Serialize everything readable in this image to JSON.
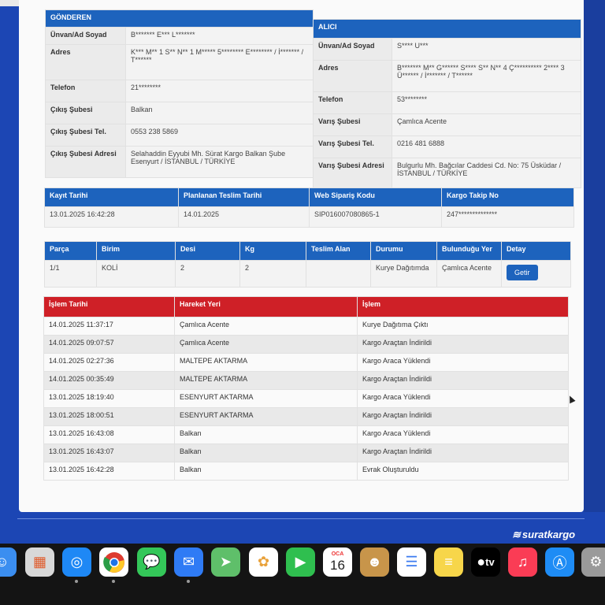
{
  "sender": {
    "header": "GÖNDEREN",
    "rows": [
      {
        "label": "Ünvan/Ad Soyad",
        "value": "B******* E*** L*******"
      },
      {
        "label": "Adres",
        "value": "K*** M** 1 S** N** 1 M***** 5******** E******** / İ******* / T******"
      },
      {
        "label": "Telefon",
        "value": "21********"
      },
      {
        "label": "Çıkış Şubesi",
        "value": "Balkan"
      },
      {
        "label": "Çıkış Şubesi Tel.",
        "value": "0553 238 5869"
      },
      {
        "label": "Çıkış Şubesi Adresi",
        "value": "Selahaddin Eyyubi Mh. Sürat Kargo Balkan Şube Esenyurt / İSTANBUL / TÜRKİYE"
      }
    ]
  },
  "receiver": {
    "header": "ALICI",
    "rows": [
      {
        "label": "Ünvan/Ad Soyad",
        "value": "S**** U***"
      },
      {
        "label": "Adres",
        "value": "B******* M** G****** S**** S** N** 4 Ç********** 2**** 3 Ü****** / İ******* / T******"
      },
      {
        "label": "Telefon",
        "value": "53********"
      },
      {
        "label": "Varış Şubesi",
        "value": "Çamlıca Acente"
      },
      {
        "label": "Varış Şubesi Tel.",
        "value": "0216 481 6888"
      },
      {
        "label": "Varış Şubesi Adresi",
        "value": "Bulgurlu Mh. Bağcılar Caddesi Cd. No: 75 Üsküdar / İSTANBUL / TÜRKİYE"
      }
    ]
  },
  "shipment": {
    "headers": [
      "Kayıt Tarihi",
      "Planlanan Teslim Tarihi",
      "Web Sipariş Kodu",
      "Kargo Takip No"
    ],
    "values": [
      "13.01.2025 16:42:28",
      "14.01.2025",
      "SIP016007080865-1",
      "247**************"
    ]
  },
  "parcel": {
    "headers": [
      "Parça",
      "Birim",
      "Desi",
      "Kg",
      "Teslim Alan",
      "Durumu",
      "Bulunduğu Yer",
      "Detay"
    ],
    "values": [
      "1/1",
      "KOLİ",
      "2",
      "2",
      "",
      "Kurye Dağıtımda",
      "Çamlıca Acente"
    ],
    "button_label": "Getir"
  },
  "movements": {
    "headers": [
      "İşlem Tarihi",
      "Hareket Yeri",
      "İşlem"
    ],
    "rows": [
      [
        "14.01.2025 11:37:17",
        "Çamlıca Acente",
        "Kurye Dağıtıma Çıktı"
      ],
      [
        "14.01.2025 09:07:57",
        "Çamlıca Acente",
        "Kargo Araçtan İndirildi"
      ],
      [
        "14.01.2025 02:27:36",
        "MALTEPE AKTARMA",
        "Kargo Araca Yüklendi"
      ],
      [
        "14.01.2025 00:35:49",
        "MALTEPE AKTARMA",
        "Kargo Araçtan İndirildi"
      ],
      [
        "13.01.2025 18:19:40",
        "ESENYURT AKTARMA",
        "Kargo Araca Yüklendi"
      ],
      [
        "13.01.2025 18:00:51",
        "ESENYURT AKTARMA",
        "Kargo Araçtan İndirildi"
      ],
      [
        "13.01.2025 16:43:08",
        "Balkan",
        "Kargo Araca Yüklendi"
      ],
      [
        "13.01.2025 16:43:07",
        "Balkan",
        "Kargo Araçtan İndirildi"
      ],
      [
        "13.01.2025 16:42:28",
        "Balkan",
        "Evrak Oluşturuldu"
      ]
    ]
  },
  "brand": {
    "logo_text": "suratkargo"
  },
  "dock": {
    "calendar_month": "OCA",
    "calendar_day": "16",
    "tv_label": "tv",
    "items": [
      {
        "icon": "finder-icon",
        "color": "#3b8ef0"
      },
      {
        "icon": "launchpad-icon",
        "color": "#f0a030"
      },
      {
        "icon": "safari-icon",
        "color": "#1e88f5"
      },
      {
        "icon": "chrome-icon",
        "color": "#ffffff"
      },
      {
        "icon": "messages-icon",
        "color": "#34c759"
      },
      {
        "icon": "mail-icon",
        "color": "#2f7bf5"
      },
      {
        "icon": "maps-icon",
        "color": "#5fbf6a"
      },
      {
        "icon": "photos-icon",
        "color": "#ffffff"
      },
      {
        "icon": "facetime-icon",
        "color": "#2fbf4f"
      },
      {
        "icon": "calendar-icon",
        "color": "#ffffff"
      },
      {
        "icon": "contacts-icon",
        "color": "#c8954a"
      },
      {
        "icon": "reminders-icon",
        "color": "#ffffff"
      },
      {
        "icon": "notes-icon",
        "color": "#f7d64a"
      },
      {
        "icon": "appletv-icon",
        "color": "#000000"
      },
      {
        "icon": "music-icon",
        "color": "#fa3c55"
      },
      {
        "icon": "appstore-icon",
        "color": "#1e8cf5"
      },
      {
        "icon": "settings-icon",
        "color": "#9a9a9a"
      }
    ]
  }
}
